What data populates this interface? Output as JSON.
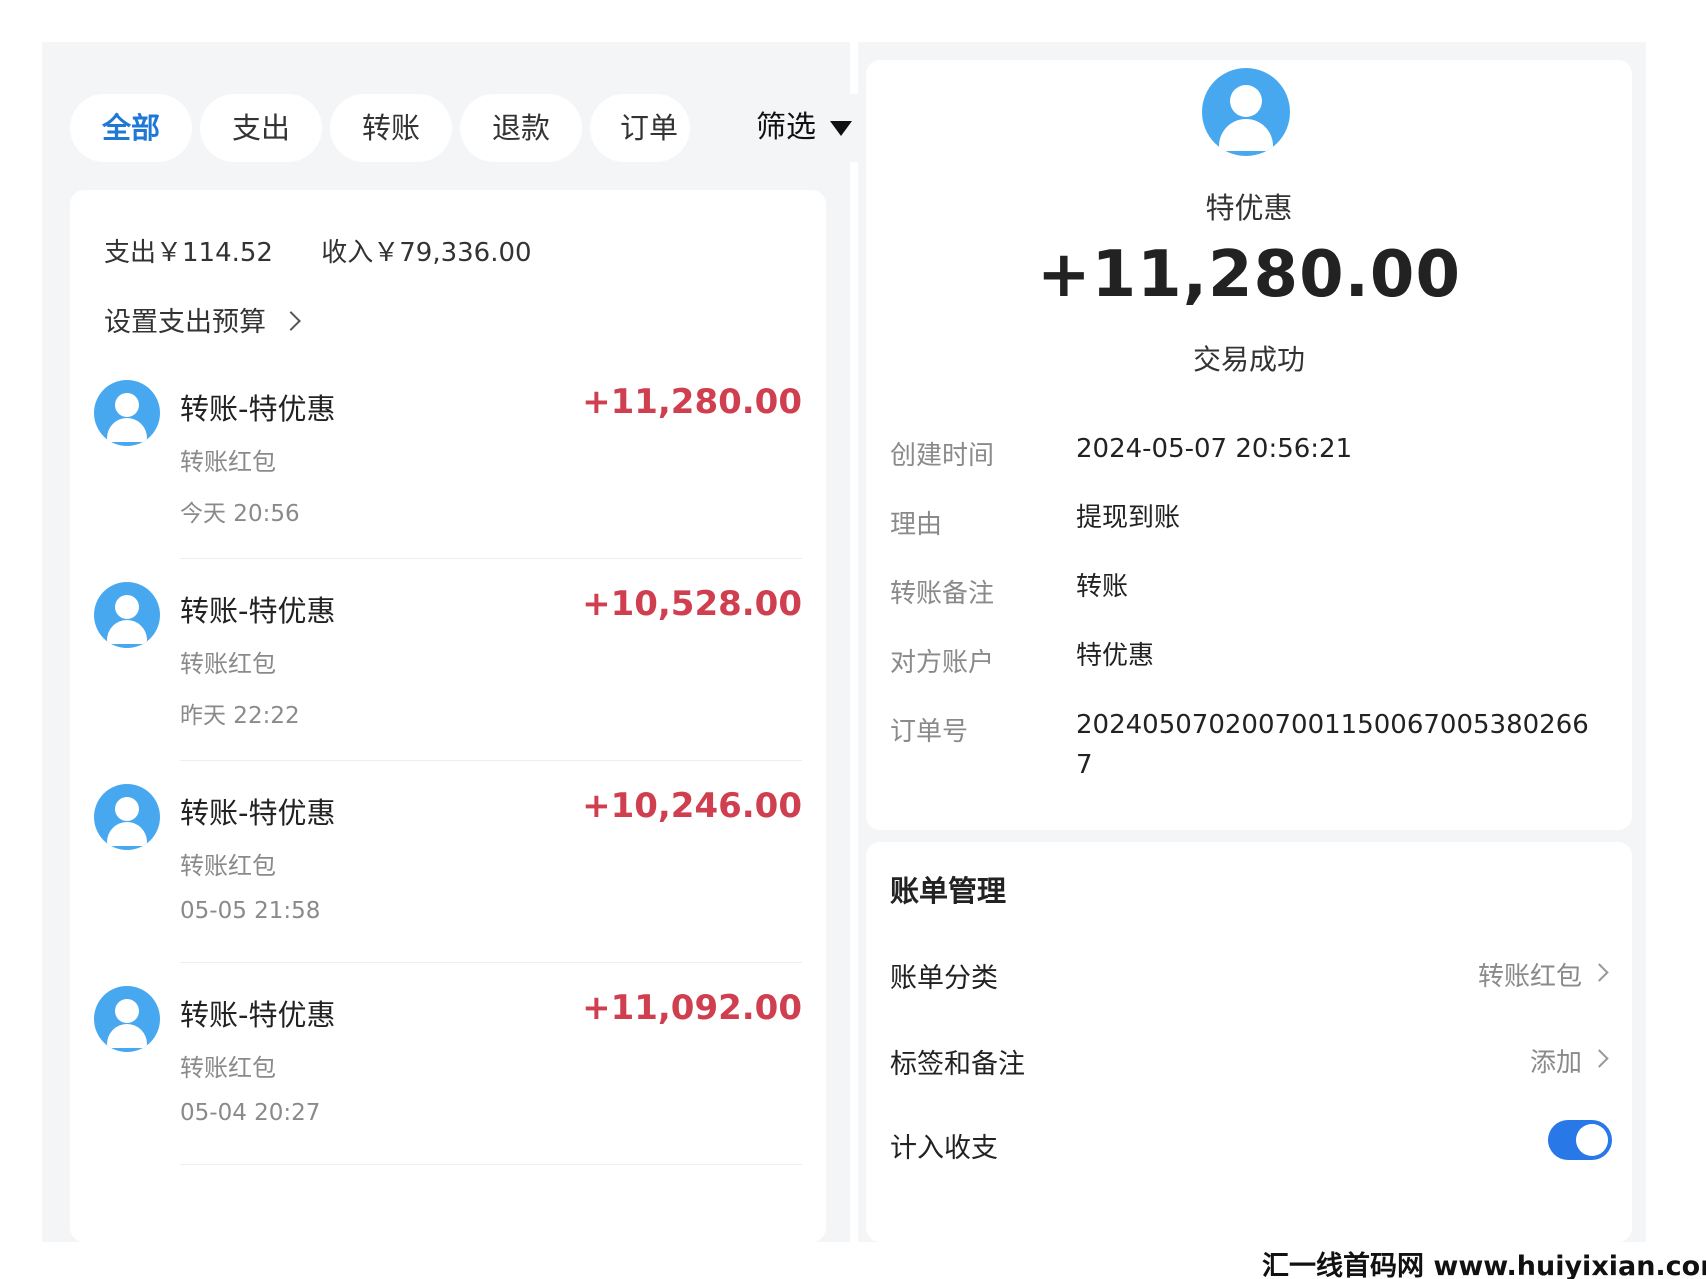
{
  "tabs": [
    {
      "label": "全部",
      "active": true
    },
    {
      "label": "支出",
      "active": false
    },
    {
      "label": "转账",
      "active": false
    },
    {
      "label": "退款",
      "active": false
    },
    {
      "label": "订单",
      "active": false
    }
  ],
  "filter": {
    "label": "筛选"
  },
  "summary": {
    "expense": "支出￥114.52",
    "income": "收入￥79,336.00"
  },
  "budget": {
    "label": "设置支出预算"
  },
  "transactions": [
    {
      "name": "转账-特优惠",
      "category": "转账红包",
      "time": "今天 20:56",
      "amount": "+11,280.00"
    },
    {
      "name": "转账-特优惠",
      "category": "转账红包",
      "time": "昨天 22:22",
      "amount": "+10,528.00"
    },
    {
      "name": "转账-特优惠",
      "category": "转账红包",
      "time": "05-05 21:58",
      "amount": "+10,246.00"
    },
    {
      "name": "转账-特优惠",
      "category": "转账红包",
      "time": "05-04 20:27",
      "amount": "+11,092.00"
    }
  ],
  "detail": {
    "payee": "特优惠",
    "amount": "+11,280.00",
    "status": "交易成功",
    "fields": [
      {
        "key": "创建时间",
        "value": "2024-05-07 20:56:21"
      },
      {
        "key": "理由",
        "value": "提现到账"
      },
      {
        "key": "转账备注",
        "value": "转账"
      },
      {
        "key": "对方账户",
        "value": "特优惠"
      },
      {
        "key": "订单号",
        "value": "20240507020070011500670053802667"
      }
    ]
  },
  "manage": {
    "title": "账单管理",
    "category_label": "账单分类",
    "category_value": "转账红包",
    "tags_label": "标签和备注",
    "tags_value": "添加",
    "include_label": "计入收支",
    "include_on": true
  },
  "watermark": "汇一线首码网 www.huiyixian.com",
  "colors": {
    "accent": "#1f78d6",
    "income": "#cf3f4f",
    "avatar": "#47a8f0",
    "toggle": "#2878e8"
  }
}
